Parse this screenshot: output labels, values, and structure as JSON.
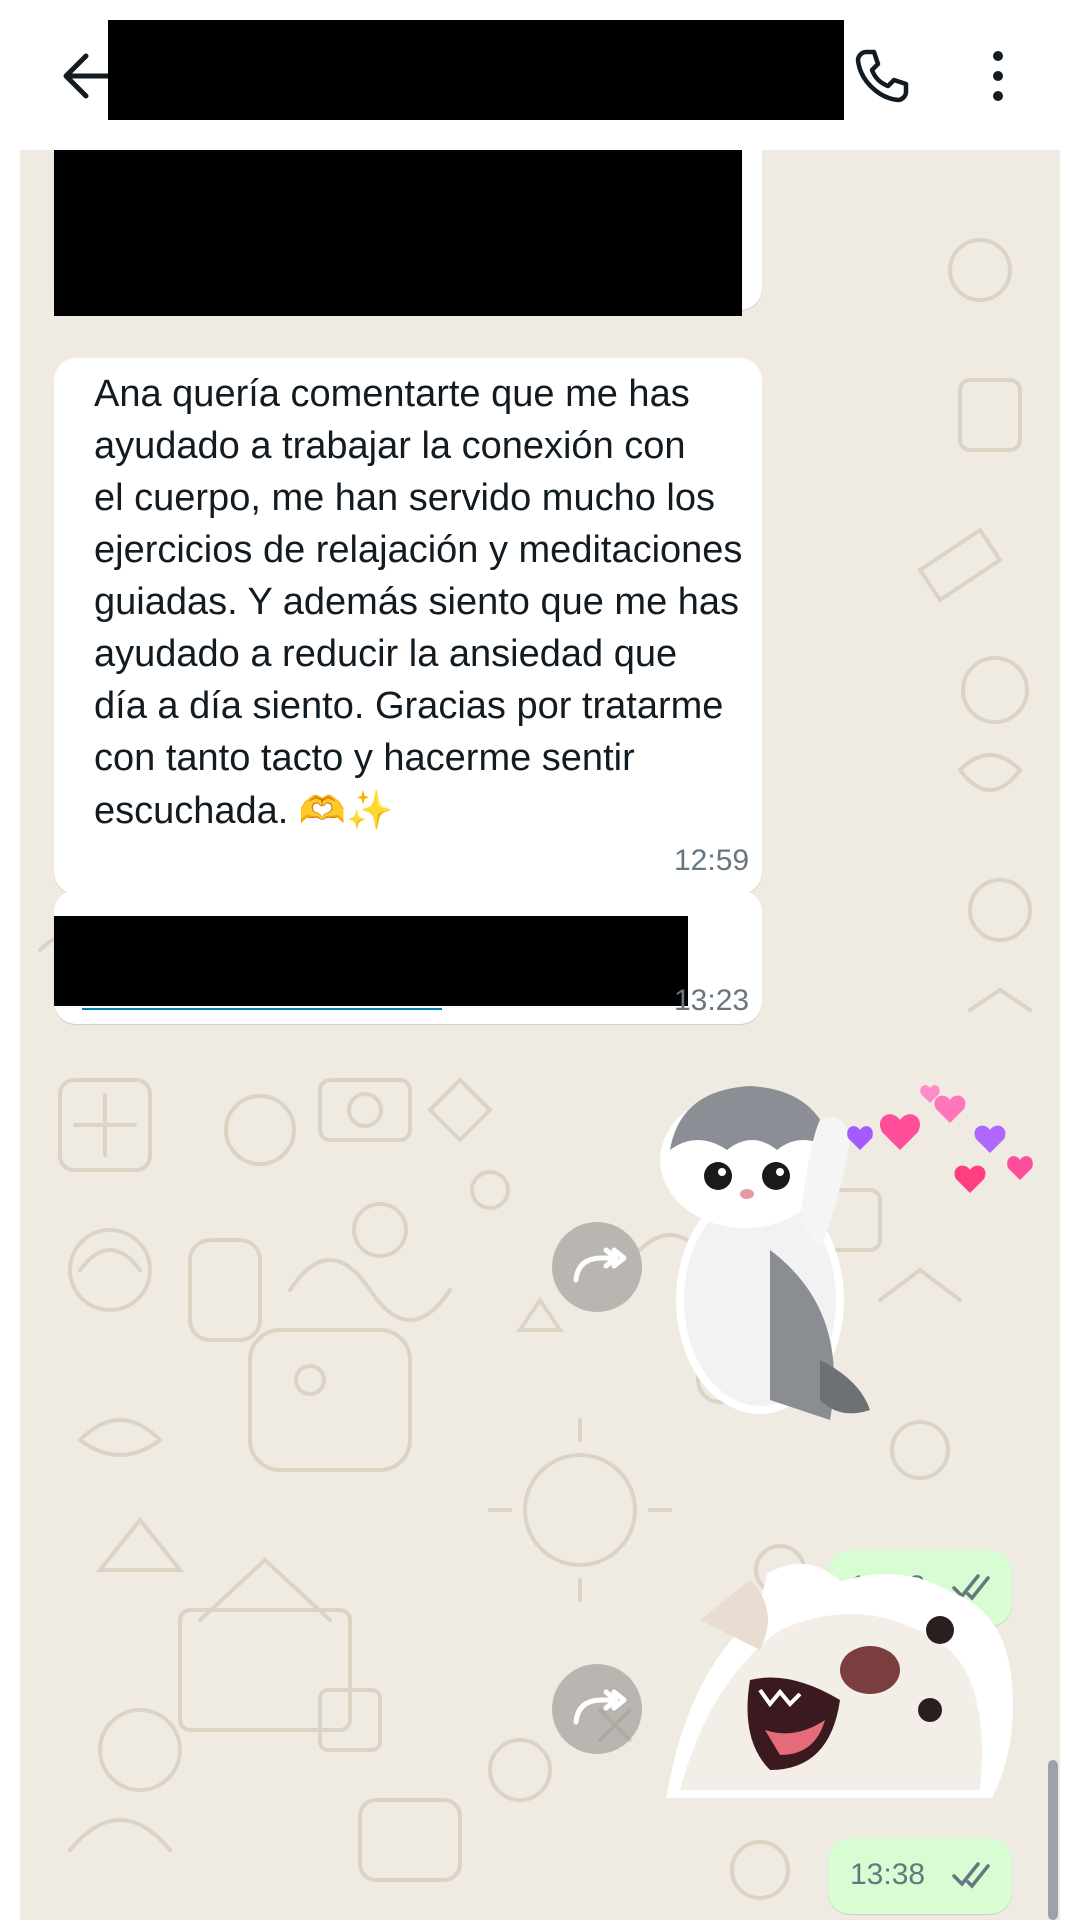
{
  "header": {
    "back_icon": "arrow-left-icon",
    "call_icon": "phone-icon",
    "menu_icon": "more-vertical-icon"
  },
  "messages": [
    {
      "type": "incoming-redacted"
    },
    {
      "type": "incoming-text",
      "text": "Ana quería comentarte que me has\nayudado a trabajar la conexión con\nel cuerpo, me han servido mucho los\nejercicios de relajación y meditaciones\nguiadas. Y además siento que me has\nayudado a reducir la ansiedad que\ndía a día siento. Gracias por tratarme\ncon tanto tacto y hacerme sentir\nescuchada. ",
      "emoji": "🫶✨",
      "time": "12:59"
    },
    {
      "type": "incoming-link-redacted",
      "time": "13:23"
    },
    {
      "type": "outgoing-sticker",
      "sticker": "kitten-hearts-sticker",
      "time": "13:38",
      "status": "read"
    },
    {
      "type": "outgoing-sticker",
      "sticker": "laughing-dog-sticker",
      "time": "13:38",
      "status": "read"
    }
  ],
  "colors": {
    "chat_bg": "#efeae2",
    "incoming_bubble": "#ffffff",
    "outgoing_bubble": "#d9fdd3",
    "link": "#027eb5"
  }
}
